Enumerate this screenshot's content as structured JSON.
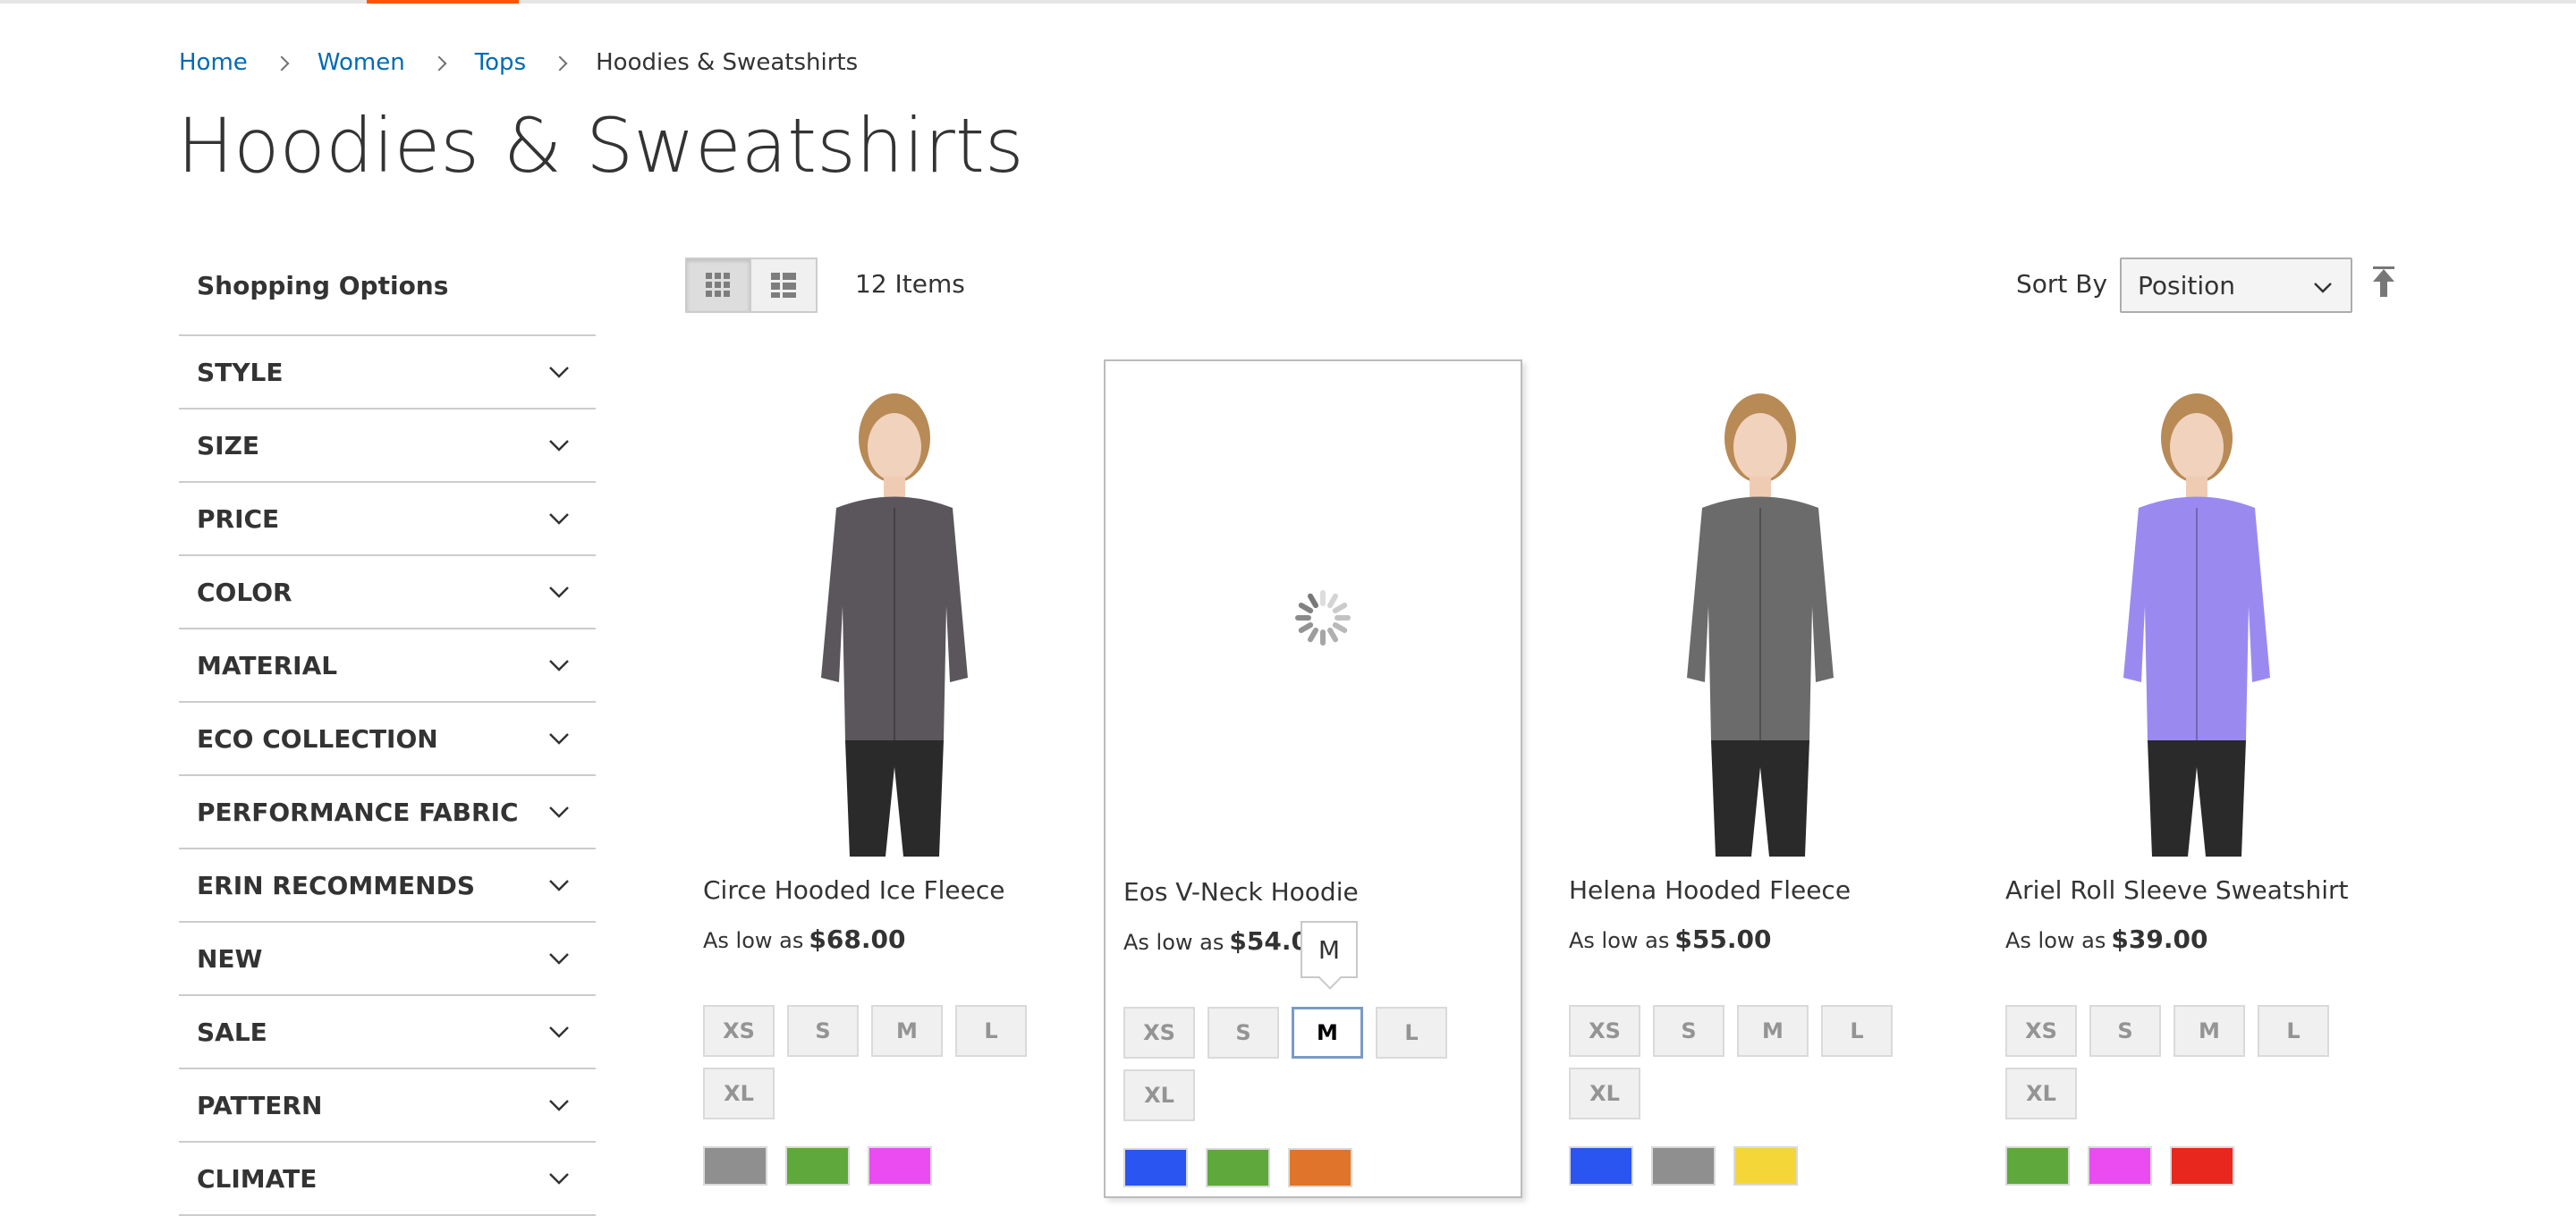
{
  "breadcrumb": {
    "items": [
      {
        "label": "Home"
      },
      {
        "label": "Women"
      },
      {
        "label": "Tops"
      }
    ],
    "current": "Hoodies & Sweatshirts"
  },
  "page_title": "Hoodies & Sweatshirts",
  "sidebar": {
    "title": "Shopping Options",
    "filters": [
      {
        "label": "STYLE"
      },
      {
        "label": "SIZE"
      },
      {
        "label": "PRICE"
      },
      {
        "label": "COLOR"
      },
      {
        "label": "MATERIAL"
      },
      {
        "label": "ECO COLLECTION"
      },
      {
        "label": "PERFORMANCE FABRIC"
      },
      {
        "label": "ERIN RECOMMENDS"
      },
      {
        "label": "NEW"
      },
      {
        "label": "SALE"
      },
      {
        "label": "PATTERN"
      },
      {
        "label": "CLIMATE"
      }
    ]
  },
  "toolbar": {
    "view_modes": [
      {
        "name": "grid",
        "active": true,
        "icon": "grid-icon"
      },
      {
        "name": "list",
        "active": false,
        "icon": "list-icon"
      }
    ],
    "items_count": "12 Items",
    "sort_label": "Sort By",
    "sort_value": "Position",
    "sort_direction_icon": "arrow-up-icon"
  },
  "products": [
    {
      "name": "Circe Hooded Ice Fleece",
      "price_prefix": "As low as",
      "price": "$68.00",
      "image_state": "loaded",
      "jacket_color": "#5a565c",
      "sizes": [
        "XS",
        "S",
        "M",
        "L",
        "XL"
      ],
      "selected_size": null,
      "colors": [
        "#8f8f8f",
        "#5fa83c",
        "#ea4cf2"
      ]
    },
    {
      "name": "Eos V-Neck Hoodie",
      "price_prefix": "As low as",
      "price": "$54.00",
      "image_state": "loading",
      "sizes": [
        "XS",
        "S",
        "M",
        "L",
        "XL"
      ],
      "selected_size": "M",
      "tooltip": "M",
      "colors": [
        "#2b55f0",
        "#5fa83c",
        "#e1742b"
      ]
    },
    {
      "name": "Helena Hooded Fleece",
      "price_prefix": "As low as",
      "price": "$55.00",
      "image_state": "loaded",
      "jacket_color": "#6b6b6b",
      "sizes": [
        "XS",
        "S",
        "M",
        "L",
        "XL"
      ],
      "selected_size": null,
      "colors": [
        "#2b55f0",
        "#8f8f8f",
        "#f5d639"
      ]
    },
    {
      "name": "Ariel Roll Sleeve Sweatshirt",
      "price_prefix": "As low as",
      "price": "$39.00",
      "image_state": "loaded",
      "jacket_color": "#9a8af0",
      "sizes": [
        "XS",
        "S",
        "M",
        "L",
        "XL"
      ],
      "selected_size": null,
      "colors": [
        "#5fa83c",
        "#ea4cf2",
        "#e8271e"
      ]
    }
  ],
  "colors": {
    "link": "#006bb4",
    "accent": "#ff5501",
    "text": "#333333"
  }
}
